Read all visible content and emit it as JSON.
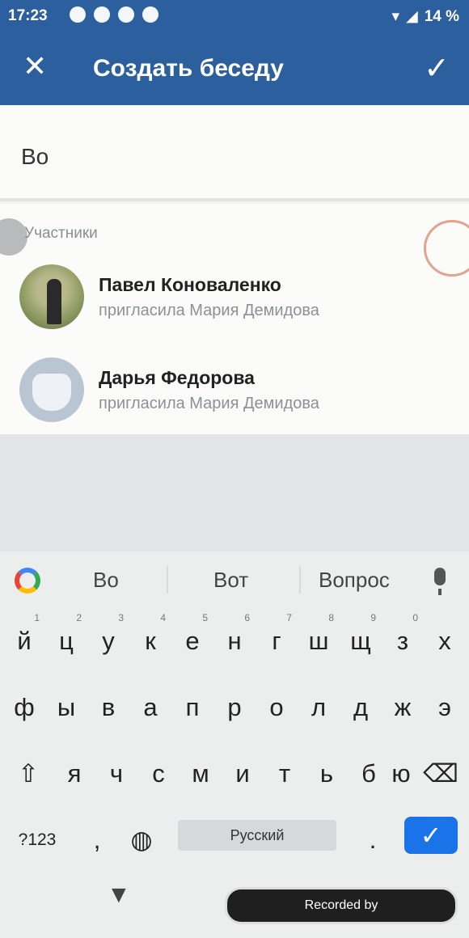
{
  "status_bar": {
    "time": "17:23",
    "battery": "14 %"
  },
  "app_bar": {
    "title": "Создать беседу",
    "close_icon": "close-icon",
    "confirm_icon": "check-icon"
  },
  "chat_name": {
    "value": "Bo"
  },
  "members": {
    "header": "Участники",
    "items": [
      {
        "name": "Павел Коноваленко",
        "subtitle": "пригласила Мария Демидова"
      },
      {
        "name": "Дарья Федорова",
        "subtitle": "пригласила Мария Демидова"
      }
    ]
  },
  "keyboard": {
    "suggestions": [
      "Во",
      "Вот",
      "Вопрос"
    ],
    "row1": [
      "й",
      "ц",
      "у",
      "к",
      "е",
      "н",
      "г",
      "ш",
      "щ",
      "з",
      "х"
    ],
    "row1_hints": [
      "1",
      "2",
      "3",
      "4",
      "5",
      "6",
      "7",
      "8",
      "9",
      "0",
      ""
    ],
    "row2": [
      "ф",
      "ы",
      "в",
      "а",
      "п",
      "р",
      "о",
      "л",
      "д",
      "ж",
      "э"
    ],
    "row3": [
      "я",
      "ч",
      "с",
      "м",
      "и",
      "т",
      "ь",
      "б",
      "ю"
    ],
    "symbols_label": "?123",
    "comma_label": ",",
    "space_label": "Русский",
    "period_label": "."
  },
  "overlay": {
    "recorder_badge": "Recorded by"
  },
  "colors": {
    "app_bar": "#2c5f9e",
    "enter_key": "#1a73e8"
  }
}
